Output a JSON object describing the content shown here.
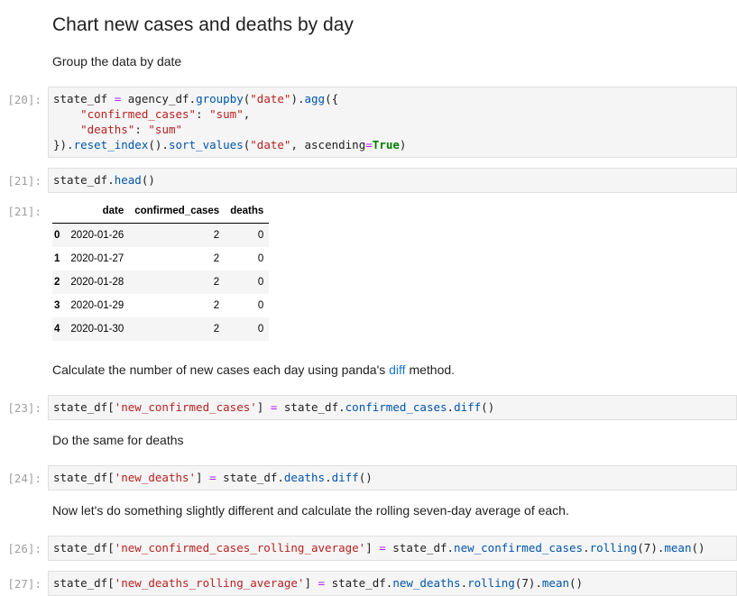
{
  "heading": "Chart new cases and deaths by day",
  "md1": "Group the data by date",
  "prompt20": "[20]:",
  "prompt21": "[21]:",
  "prompt21out": "[21]:",
  "prompt23": "[23]:",
  "prompt24": "[24]:",
  "prompt26": "[26]:",
  "prompt27": "[27]:",
  "code20": {
    "l1a": "state_df ",
    "l1eq": "=",
    "l1b": " agency_df.",
    "l1f1": "groupby",
    "l1c": "(",
    "l1s1": "\"date\"",
    "l1d": ").",
    "l1f2": "agg",
    "l1e": "({",
    "l2s1": "\"confirmed_cases\"",
    "l2a": ": ",
    "l2s2": "\"sum\"",
    "l2b": ",",
    "l3s1": "\"deaths\"",
    "l3a": ": ",
    "l3s2": "\"sum\"",
    "l4a": "}).",
    "l4f1": "reset_index",
    "l4b": "().",
    "l4f2": "sort_values",
    "l4c": "(",
    "l4s1": "\"date\"",
    "l4d": ", ascending",
    "l4eq": "=",
    "l4k": "True",
    "l4e": ")"
  },
  "code21": {
    "a": "state_df.",
    "f": "head",
    "b": "()"
  },
  "table": {
    "columns": [
      "date",
      "confirmed_cases",
      "deaths"
    ],
    "rows": [
      {
        "idx": "0",
        "date": "2020-01-26",
        "confirmed_cases": "2",
        "deaths": "0"
      },
      {
        "idx": "1",
        "date": "2020-01-27",
        "confirmed_cases": "2",
        "deaths": "0"
      },
      {
        "idx": "2",
        "date": "2020-01-28",
        "confirmed_cases": "2",
        "deaths": "0"
      },
      {
        "idx": "3",
        "date": "2020-01-29",
        "confirmed_cases": "2",
        "deaths": "0"
      },
      {
        "idx": "4",
        "date": "2020-01-30",
        "confirmed_cases": "2",
        "deaths": "0"
      }
    ]
  },
  "md2": {
    "before": "Calculate the number of new cases each day using panda's ",
    "link": "diff",
    "after": " method."
  },
  "code23": {
    "a": "state_df[",
    "s": "'new_confirmed_cases'",
    "b": "] ",
    "eq": "=",
    "c": " state_df.",
    "f1": "confirmed_cases",
    "d": ".",
    "f2": "diff",
    "e": "()"
  },
  "md3": "Do the same for deaths",
  "code24": {
    "a": "state_df[",
    "s": "'new_deaths'",
    "b": "] ",
    "eq": "=",
    "c": " state_df.",
    "f1": "deaths",
    "d": ".",
    "f2": "diff",
    "e": "()"
  },
  "md4": "Now let's do something slightly different and calculate the rolling seven-day average of each.",
  "code26": {
    "a": "state_df[",
    "s": "'new_confirmed_cases_rolling_average'",
    "b": "] ",
    "eq": "=",
    "c": " state_df.",
    "f1": "new_confirmed_cases",
    "d": ".",
    "f2": "rolling",
    "e": "(7).",
    "f3": "mean",
    "g": "()"
  },
  "code27": {
    "a": "state_df[",
    "s": "'new_deaths_rolling_average'",
    "b": "] ",
    "eq": "=",
    "c": " state_df.",
    "f1": "new_deaths",
    "d": ".",
    "f2": "rolling",
    "e": "(7).",
    "f3": "mean",
    "g": "()"
  }
}
